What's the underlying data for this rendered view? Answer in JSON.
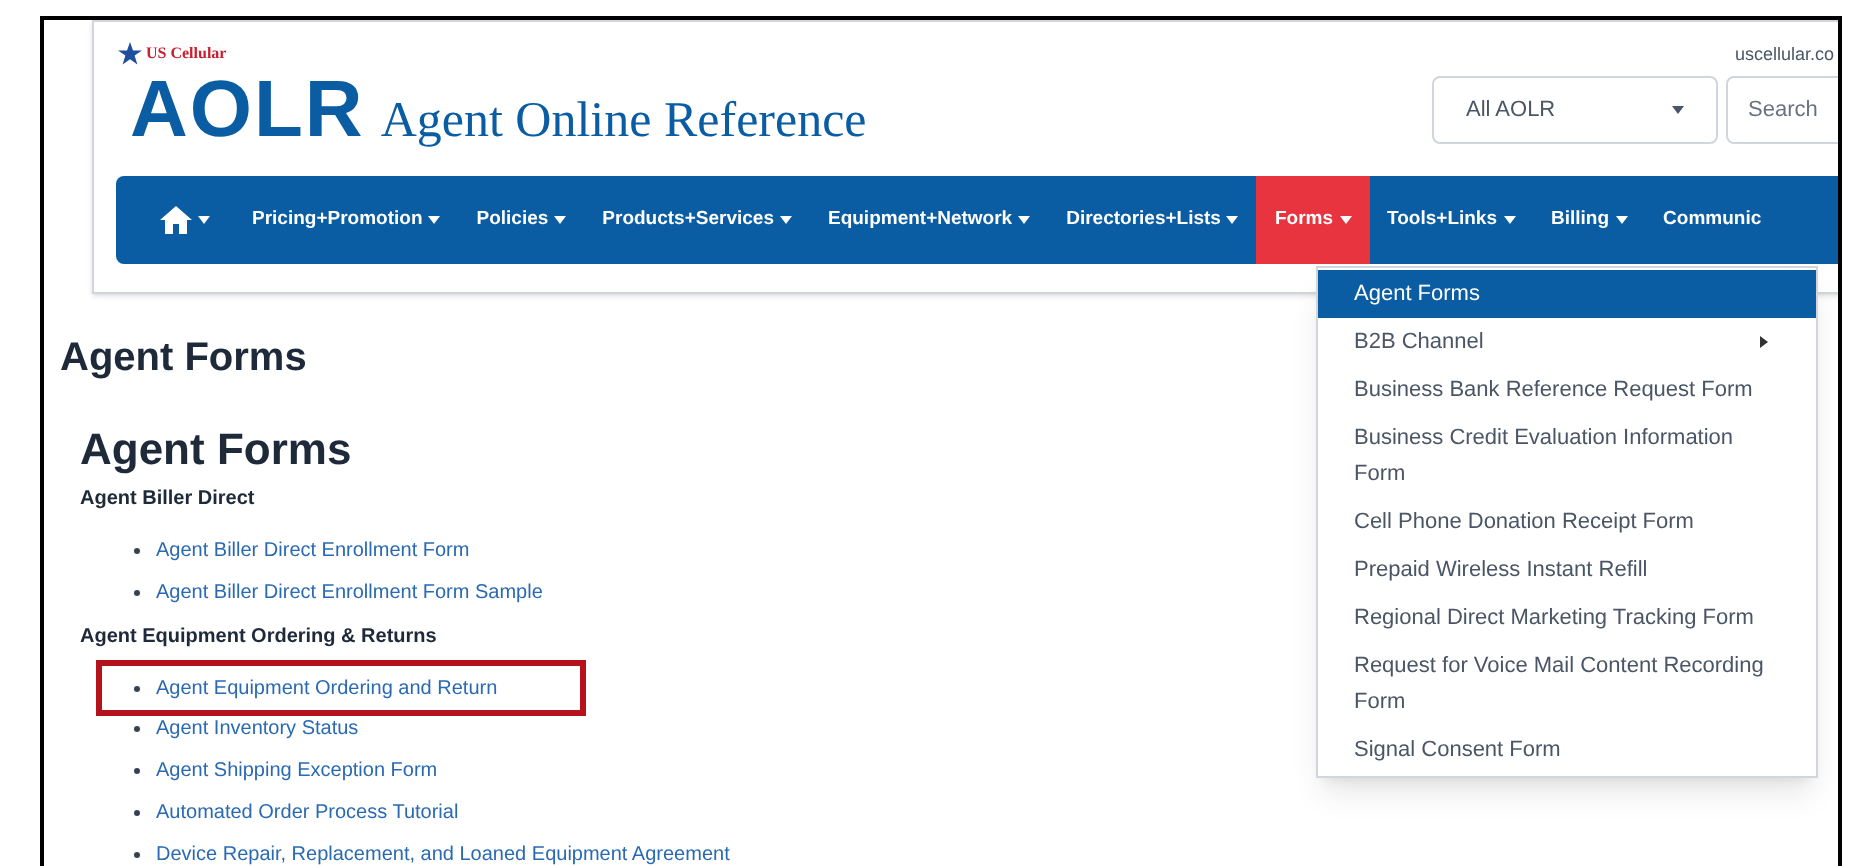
{
  "header": {
    "brand": "US Cellular",
    "logo": "AOLR",
    "tagline": "Agent Online Reference",
    "site_link": "uscellular.co",
    "scope_select": {
      "value": "All AOLR"
    },
    "search": {
      "placeholder": "Search"
    }
  },
  "nav": [
    {
      "label": "Pricing+Promotion",
      "selected": false
    },
    {
      "label": "Policies",
      "selected": false
    },
    {
      "label": "Products+Services",
      "selected": false
    },
    {
      "label": "Equipment+Network",
      "selected": false
    },
    {
      "label": "Directories+Lists",
      "selected": false
    },
    {
      "label": "Forms",
      "selected": true
    },
    {
      "label": "Tools+Links",
      "selected": false
    },
    {
      "label": "Billing",
      "selected": false
    },
    {
      "label": "Communic",
      "selected": false
    }
  ],
  "dropdown": [
    {
      "label": "Agent Forms",
      "selected": true,
      "submenu": false
    },
    {
      "label": "B2B Channel",
      "selected": false,
      "submenu": true
    },
    {
      "label": "Business Bank Reference Request Form",
      "selected": false,
      "submenu": false
    },
    {
      "label": "Business Credit Evaluation Information Form",
      "selected": false,
      "submenu": false
    },
    {
      "label": "Cell Phone Donation Receipt Form",
      "selected": false,
      "submenu": false
    },
    {
      "label": "Prepaid Wireless Instant Refill",
      "selected": false,
      "submenu": false
    },
    {
      "label": "Regional Direct Marketing Tracking Form",
      "selected": false,
      "submenu": false
    },
    {
      "label": "Request for Voice Mail Content Recording Form",
      "selected": false,
      "submenu": false
    },
    {
      "label": "Signal Consent Form",
      "selected": false,
      "submenu": false
    }
  ],
  "page_title": "Agent Forms",
  "section_title": "Agent Forms",
  "groups": [
    {
      "title": "Agent Biller Direct",
      "links": [
        {
          "label": "Agent Biller Direct Enrollment Form",
          "highlighted": false
        },
        {
          "label": "Agent Biller Direct Enrollment Form Sample",
          "highlighted": false
        }
      ]
    },
    {
      "title": "Agent Equipment Ordering & Returns",
      "links": [
        {
          "label": "Agent Equipment Ordering and Return",
          "highlighted": true
        },
        {
          "label": "Agent Inventory Status",
          "highlighted": false
        },
        {
          "label": "Agent Shipping Exception Form",
          "highlighted": false
        },
        {
          "label": "Automated Order Process Tutorial",
          "highlighted": false
        },
        {
          "label": "Device Repair, Replacement, and Loaned Equipment Agreement",
          "highlighted": false
        }
      ]
    }
  ]
}
